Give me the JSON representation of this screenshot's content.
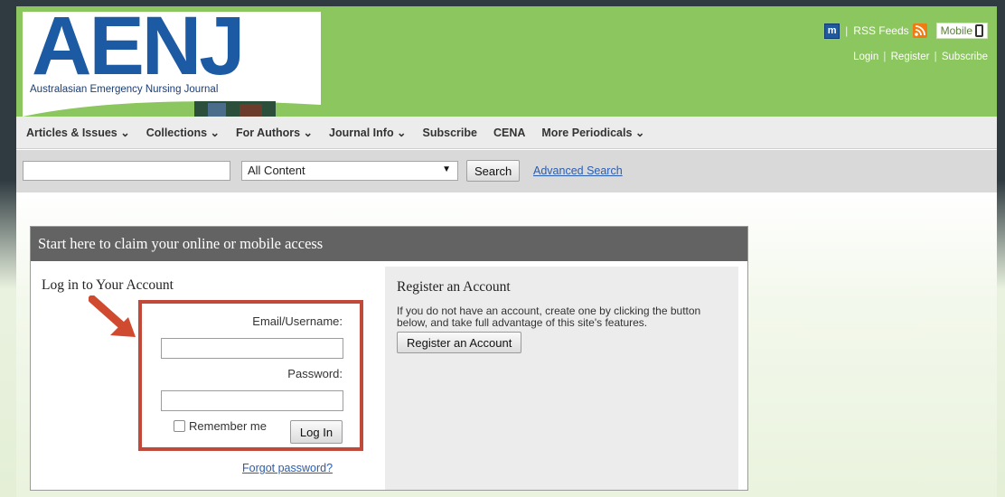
{
  "header": {
    "logo_text": "AENJ",
    "logo_subtitle": "Australasian Emergency Nursing Journal",
    "mobile_icon_letter": "m",
    "rss_label": "RSS Feeds",
    "mobile_label": "Mobile",
    "login_label": "Login",
    "register_label": "Register",
    "subscribe_label": "Subscribe",
    "separator": "|"
  },
  "nav": {
    "items": [
      {
        "label": "Articles & Issues ⌄"
      },
      {
        "label": "Collections ⌄"
      },
      {
        "label": "For Authors ⌄"
      },
      {
        "label": "Journal Info ⌄"
      },
      {
        "label": "Subscribe"
      },
      {
        "label": "CENA"
      },
      {
        "label": "More Periodicals ⌄"
      }
    ]
  },
  "search": {
    "query": "",
    "content_selected": "All Content",
    "button_label": "Search",
    "advanced_label": "Advanced Search"
  },
  "panel": {
    "heading": "Start here to claim your online or mobile access",
    "login": {
      "title": "Log in to Your Account",
      "email_label": "Email/Username:",
      "password_label": "Password:",
      "remember_label": "Remember me",
      "login_button": "Log In",
      "forgot_label": "Forgot password?"
    },
    "register": {
      "title": "Register an Account",
      "description": "If you do not have an account, create one by clicking the button below, and take full advantage of this site's features.",
      "button_label": "Register an Account"
    }
  },
  "colors": {
    "header_green": "#8cc65e",
    "logo_blue": "#1c5aa4",
    "panel_header": "#636363",
    "highlight": "#c0493a",
    "link_blue": "#2a5db0"
  }
}
